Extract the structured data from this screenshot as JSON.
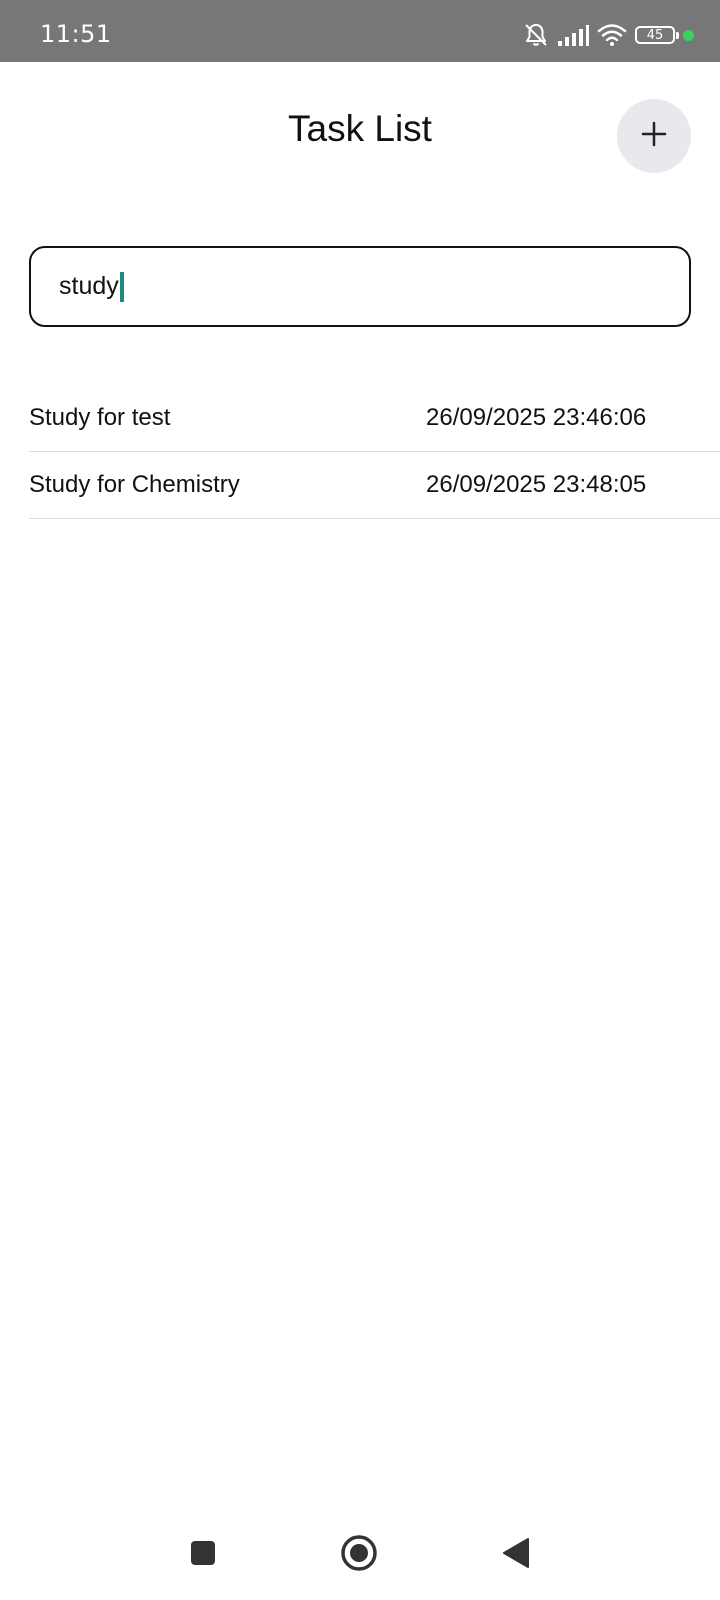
{
  "status_bar": {
    "time": "11:51",
    "battery_level": "45",
    "icons": [
      "bell-muted-icon",
      "signal-icon",
      "wifi-icon",
      "battery-icon",
      "green-dot-indicator"
    ]
  },
  "header": {
    "title": "Task List",
    "add_button_icon": "plus-icon"
  },
  "search": {
    "value": "study"
  },
  "tasks": [
    {
      "title": "Study for test",
      "date": "26/09/2025 23:46:06"
    },
    {
      "title": "Study for Chemistry",
      "date": "26/09/2025 23:48:05"
    }
  ],
  "nav_bar": {
    "buttons": [
      "recents-square-icon",
      "home-circle-icon",
      "back-triangle-icon"
    ]
  },
  "colors": {
    "status_bar_bg": "#777777",
    "add_button_bg": "#e8e9ed",
    "caret": "#1f8a7f",
    "indicator_dot": "#3ad15a"
  }
}
